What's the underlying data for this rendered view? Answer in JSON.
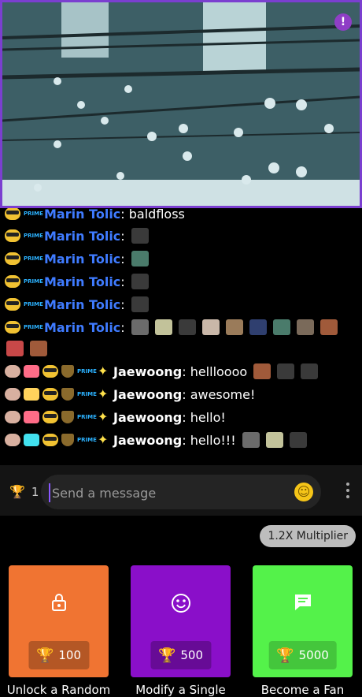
{
  "stream": {
    "alert_icon": "!"
  },
  "chat": {
    "messages": [
      {
        "user": "Marin Tolic",
        "text": ": baldfloss"
      },
      {
        "user": "Marin Tolic",
        "text": ":"
      },
      {
        "user": "Marin Tolic",
        "text": ":"
      },
      {
        "user": "Marin Tolic",
        "text": ":"
      },
      {
        "user": "Marin Tolic",
        "text": ":"
      },
      {
        "user": "Marin Tolic",
        "text": ":"
      },
      {
        "user": "Jaewoong",
        "text": ": hellloooo"
      },
      {
        "user": "Jaewoong",
        "text": ": awesome!"
      },
      {
        "user": "Jaewoong",
        "text": ": hello!"
      },
      {
        "user": "Jaewoong",
        "text": ": hello!!!"
      }
    ],
    "prime_badge": "PRIME"
  },
  "input": {
    "trophy_count": "1",
    "placeholder": "Send a message"
  },
  "multiplier": "1.2X Multiplier",
  "rewards": [
    {
      "cost": "100",
      "label": "Unlock a Random",
      "color": "#f07432",
      "icon": "lock-icon"
    },
    {
      "cost": "500",
      "label": "Modify a Single",
      "color": "#8a0fc9",
      "icon": "smiley-icon"
    },
    {
      "cost": "5000",
      "label": "Become a Fan",
      "color": "#54f24a",
      "icon": "chat-bubble-icon"
    }
  ]
}
